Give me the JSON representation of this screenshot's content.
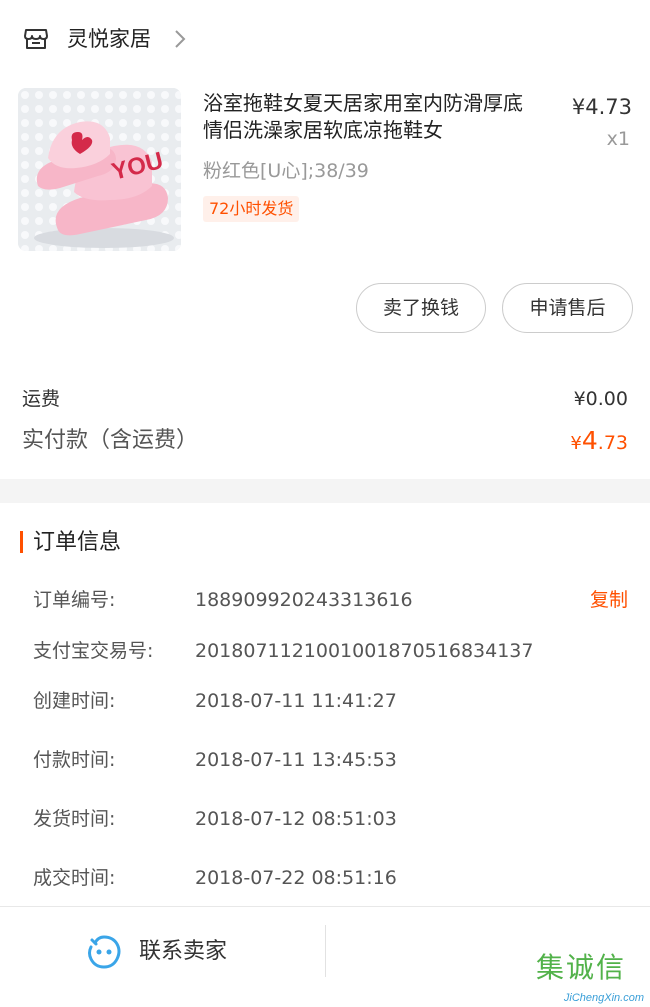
{
  "store": {
    "name": "灵悦家居"
  },
  "product": {
    "title": "浴室拖鞋女夏天居家用室内防滑厚底情侣洗澡家居软底凉拖鞋女",
    "price": "¥4.73",
    "qty": "x1",
    "sku": "粉红色[U心];38/39",
    "shipping_badge": "72小时发货",
    "thumb_text": "YOU"
  },
  "actions": {
    "sell_label": "卖了换钱",
    "after_sale_label": "申请售后"
  },
  "fees": {
    "freight_label": "运费",
    "freight_value": "¥0.00",
    "total_label": "实付款（含运费）",
    "total_currency": "¥",
    "total_int": "4",
    "total_dec": ".73"
  },
  "order_info": {
    "title": "订单信息",
    "copy_label": "复制",
    "rows": [
      {
        "label": "订单编号:",
        "value": "188909920243313616"
      },
      {
        "label": "支付宝交易号:",
        "value": "2018071121001001870516834137"
      },
      {
        "label": "创建时间:",
        "value": "2018-07-11 11:41:27"
      },
      {
        "label": "付款时间:",
        "value": "2018-07-11 13:45:53"
      },
      {
        "label": "发货时间:",
        "value": "2018-07-12 08:51:03"
      },
      {
        "label": "成交时间:",
        "value": "2018-07-22 08:51:16"
      }
    ]
  },
  "bottom": {
    "contact_label": "联系卖家"
  },
  "watermark": {
    "top": "集诚信",
    "bottom": "JiChengXin.com"
  },
  "colors": {
    "accent": "#ff5000",
    "contact_icon": "#3aa5e8"
  }
}
